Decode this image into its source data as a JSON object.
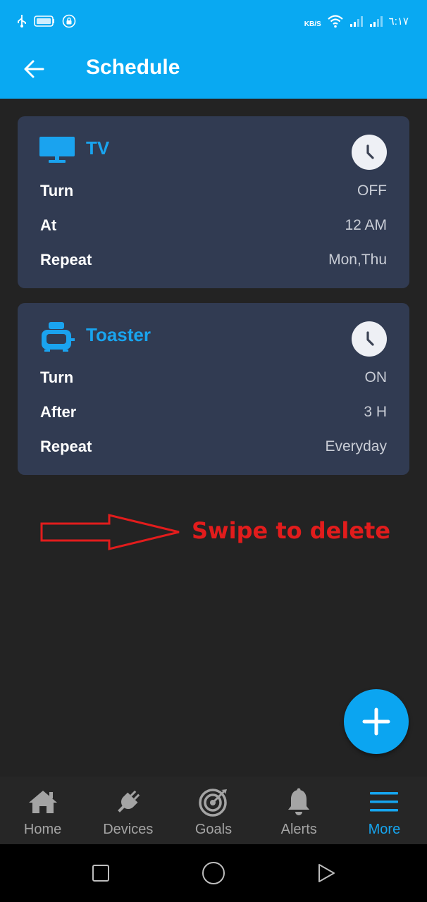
{
  "status_bar": {
    "speed_unit": "KB/S",
    "time": "٦:١٧"
  },
  "header": {
    "title": "Schedule",
    "back_icon": "arrow-left-icon"
  },
  "schedules": [
    {
      "device": "TV",
      "icon": "tv-icon",
      "rows": [
        {
          "label": "Turn",
          "value": "OFF"
        },
        {
          "label": "At",
          "value": "12 AM"
        },
        {
          "label": "Repeat",
          "value": "Mon,Thu"
        }
      ]
    },
    {
      "device": "Toaster",
      "icon": "toaster-icon",
      "rows": [
        {
          "label": "Turn",
          "value": "ON"
        },
        {
          "label": "After",
          "value": "3 H"
        },
        {
          "label": "Repeat",
          "value": "Everyday"
        }
      ]
    }
  ],
  "hint": {
    "text": "Swipe to delete",
    "color": "#e21c1c"
  },
  "fab": {
    "icon": "plus-icon"
  },
  "bottom_nav": [
    {
      "label": "Home",
      "icon": "home-icon",
      "active": false
    },
    {
      "label": "Devices",
      "icon": "plug-icon",
      "active": false
    },
    {
      "label": "Goals",
      "icon": "target-icon",
      "active": false
    },
    {
      "label": "Alerts",
      "icon": "bell-icon",
      "active": false
    },
    {
      "label": "More",
      "icon": "menu-icon",
      "active": true
    }
  ],
  "colors": {
    "primary": "#09a9f2",
    "background": "#232323",
    "card": "#313b52",
    "accent_text": "#19a4ef"
  }
}
